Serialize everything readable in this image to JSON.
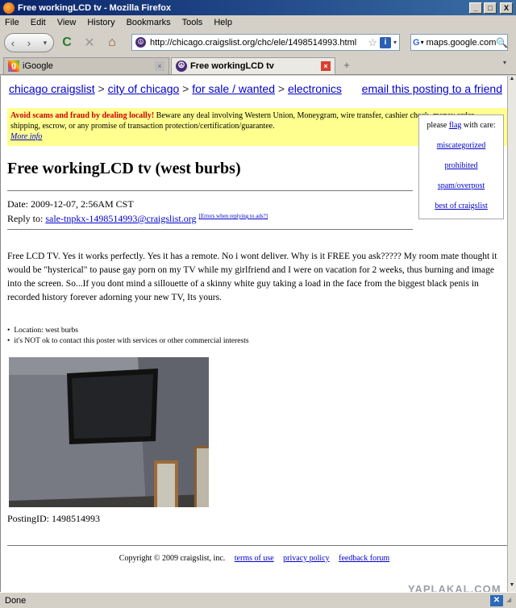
{
  "window": {
    "title": "Free workingLCD tv - Mozilla Firefox",
    "buttons": {
      "min": "_",
      "max": "□",
      "close": "X"
    }
  },
  "menu": [
    "File",
    "Edit",
    "View",
    "History",
    "Bookmarks",
    "Tools",
    "Help"
  ],
  "toolbar": {
    "url": "http://chicago.craigslist.org/chc/ele/1498514993.html",
    "search_value": "maps.google.com",
    "search_engine_icon": "google-icon",
    "glyphs": {
      "back": "‹",
      "forward": "›",
      "history_dd": "▾",
      "reload": "C",
      "stop": "✕",
      "home": "⌂",
      "site": "☮",
      "star": "☆",
      "info": "i",
      "url_dd": "▾",
      "search_engine": "G",
      "search_dd": "▾",
      "search_go": "🔍"
    }
  },
  "tabs": {
    "items": [
      {
        "label": "iGoogle",
        "icon": "igoogle-icon",
        "glyph": "g",
        "close": "×"
      },
      {
        "label": "Free workingLCD tv",
        "icon": "craigslist-peace-icon",
        "glyph": "☮",
        "close": "×"
      }
    ],
    "new_tab": "+",
    "scroll": "▾"
  },
  "scrollbar": {
    "up": "▲",
    "down": "▼"
  },
  "breadcrumb": {
    "site": "chicago craigslist",
    "city": "city of chicago",
    "section": "for sale / wanted",
    "category": "electronics",
    "sep": " > ",
    "email_link": "email this posting to a friend"
  },
  "warning": {
    "bold": "Avoid scams and fraud by dealing locally!",
    "text": " Beware any deal involving Western Union, Moneygram, wire transfer, cashier check, money order, shipping, escrow, or any promise of transaction protection/certification/guarantee.",
    "more": "More info"
  },
  "flag": {
    "prefix": "please ",
    "link": "flag",
    "suffix": " with care:",
    "options": [
      "miscategorized",
      "prohibited",
      "spam/overpost",
      "best of craigslist"
    ]
  },
  "posting": {
    "title": "Free workingLCD tv (west burbs)",
    "date_label": "Date: ",
    "date": "2009-12-07, 2:56AM CST",
    "reply_label": "Reply to: ",
    "reply_email": "sale-tnpkx-1498514993@craigslist.org",
    "reply_errors": "[Errors when replying to ads?]",
    "body": "Free LCD TV. Yes it works perfectly. Yes it has a remote. No i wont deliver. Why is it FREE you ask????? My room mate thought it would be \"hysterical\" to pause gay porn on my TV while my girlfriend and I were on vacation for 2 weeks, thus burning and image into the screen. So...If you dont mind a sillouette of a skinny white guy taking a load in the face from the biggest black penis in recorded history forever adorning your new TV, Its yours.",
    "location": "Location: west burbs",
    "contact_note": "it's NOT ok to contact this poster with services or other commercial interests",
    "posting_id_label": "PostingID: ",
    "posting_id": "1498514993"
  },
  "footer": {
    "copyright": "Copyright © 2009 craigslist, inc.",
    "links": [
      "terms of use",
      "privacy policy",
      "feedback forum"
    ]
  },
  "watermark": "YAPLAKAL.COM",
  "status": {
    "text": "Done",
    "xmarks_glyph": "✕",
    "grip": "◢"
  }
}
